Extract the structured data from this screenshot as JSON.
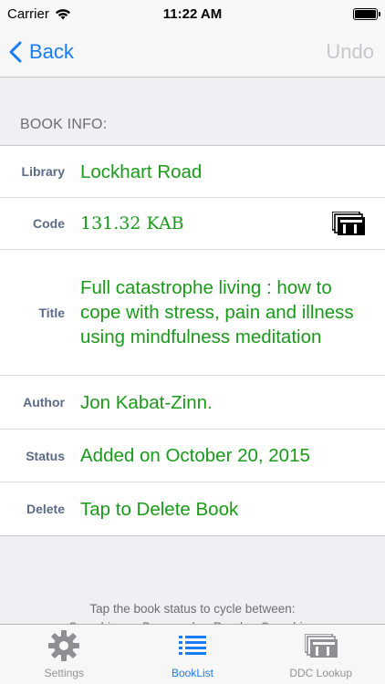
{
  "status_bar": {
    "carrier": "Carrier",
    "time": "11:22 AM"
  },
  "nav": {
    "back_label": "Back",
    "undo_label": "Undo"
  },
  "section_header": "BOOK INFO:",
  "book": {
    "rows": [
      {
        "label": "Library",
        "value": "Lockhart Road"
      },
      {
        "label": "Code",
        "value": "131.32 KAB"
      },
      {
        "label": "Title",
        "value": "Full catastrophe living : how to cope with stress, pain and illness using mindfulness meditation"
      },
      {
        "label": "Author",
        "value": "Jon Kabat-Zinn."
      },
      {
        "label": "Status",
        "value": "Added on October 20, 2015"
      },
      {
        "label": "Delete",
        "value": "Tap to Delete Book"
      }
    ]
  },
  "footer": {
    "line1": "Tap the book status to cycle between:",
    "line2": "Searching -> Borrowed -> Read -> Searching"
  },
  "tabs": [
    {
      "label": "Settings",
      "icon": "gear-icon",
      "active": false
    },
    {
      "label": "BookList",
      "icon": "list-icon",
      "active": true
    },
    {
      "label": "DDC Lookup",
      "icon": "cards-icon",
      "active": false
    }
  ],
  "colors": {
    "accent": "#1a7cf5",
    "value_green": "#1a9a1a",
    "label_slate": "#5b6b86"
  }
}
